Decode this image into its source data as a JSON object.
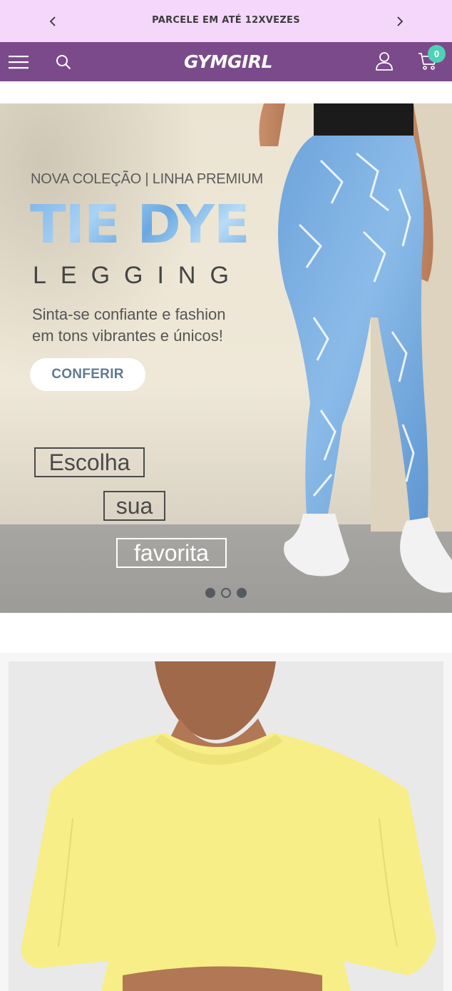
{
  "announcement": {
    "text": "PARCELE EM ATÉ 12XVEZES"
  },
  "header": {
    "logo_text": "GYMGIRL",
    "cart_count": "0"
  },
  "hero": {
    "subtitle": "NOVA COLEÇÃO | LINHA PREMIUM",
    "headline": "TIE DYE",
    "word": "LEGGING",
    "tagline_line1": "Sinta-se confiante e fashion",
    "tagline_line2": "em tons vibrantes e únicos!",
    "cta_label": "CONFERIR",
    "boxed_1": "Escolha",
    "boxed_2": "sua",
    "boxed_3": "favorita",
    "slide_count": 3,
    "active_slide": 2
  },
  "colors": {
    "announcement_bg": "#f4d7fb",
    "header_bg": "#7a4a8a",
    "cart_badge": "#4fd1b5",
    "headline_blue": "#7fb6e8"
  },
  "icons": {
    "prev": "chevron-left-icon",
    "next": "chevron-right-icon",
    "menu": "hamburger-menu-icon",
    "search": "search-icon",
    "account": "user-icon",
    "cart": "cart-icon"
  }
}
